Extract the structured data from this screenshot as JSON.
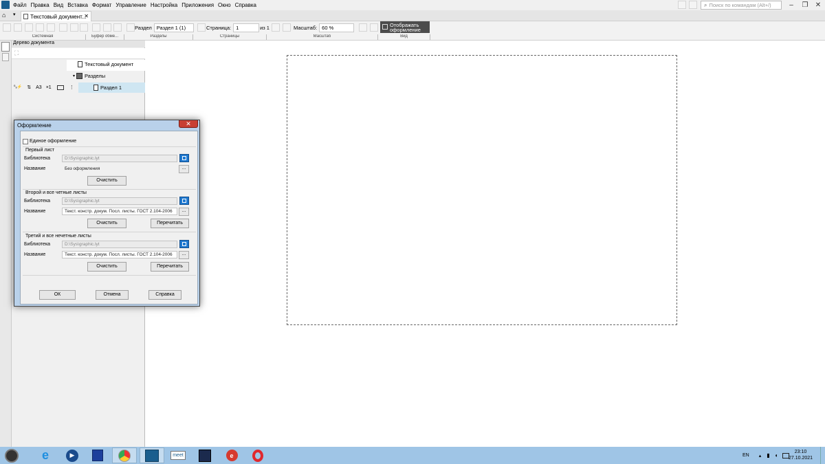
{
  "menubar": {
    "items": [
      "Файл",
      "Правка",
      "Вид",
      "Вставка",
      "Формат",
      "Управление",
      "Настройка",
      "Приложения",
      "Окно",
      "Справка"
    ]
  },
  "search": {
    "placeholder": "Поиск по командам (Alt+/)"
  },
  "tab": {
    "label": "Текстовый документ..."
  },
  "toolbar": {
    "section_label": "Раздел",
    "section_value": "Раздел 1 (1)",
    "page_label": "Страница:",
    "page_value": "1",
    "page_of": "из 1",
    "zoom_label": "Масштаб:",
    "zoom_value": "60 %",
    "display_label": "Отображать оформление",
    "groups": [
      "Системная",
      "Буфер обме...",
      "Разделы",
      "Страницы",
      "Масштаб",
      "Вид"
    ]
  },
  "tree": {
    "title": "Дерево документа",
    "root": "Текстовый документ",
    "sections": "Разделы",
    "section1": "Раздел 1",
    "format_a3": "A3",
    "format_mult": "×1"
  },
  "dialog": {
    "title": "Оформление",
    "unified": "Единое оформление",
    "library_label": "Библиотека",
    "name_label": "Название",
    "first": {
      "title": "Первый лист",
      "library": "D:\\Sys\\graphic.lyt",
      "name": "Без оформления",
      "clear": "Очистить"
    },
    "second": {
      "title": "Второй и все четные листы",
      "library": "D:\\Sys\\graphic.lyt",
      "name": "Текст. констр. докум. Посл. листы. ГОСТ 2.104-2006",
      "clear": "Очистить",
      "reread": "Перечитать"
    },
    "third": {
      "title": "Третий и все нечетные листы",
      "library": "D:\\Sys\\graphic.lyt",
      "name": "Текст. констр. докум. Посл. листы. ГОСТ 2.104-2006",
      "clear": "Очистить",
      "reread": "Перечитать"
    },
    "ok": "ОК",
    "cancel": "Отмена",
    "help": "Справка"
  },
  "taskbar": {
    "meet_label": "meet",
    "lang": "EN",
    "time": "23:10",
    "date": "27.10.2021"
  },
  "colors": {
    "accent": "#1a5e8e",
    "taskbar": "#9fc5e6",
    "dialog_frame": "#b9d1ea",
    "close": "#c84034",
    "toolbar_dark": "#4c4c4c"
  }
}
